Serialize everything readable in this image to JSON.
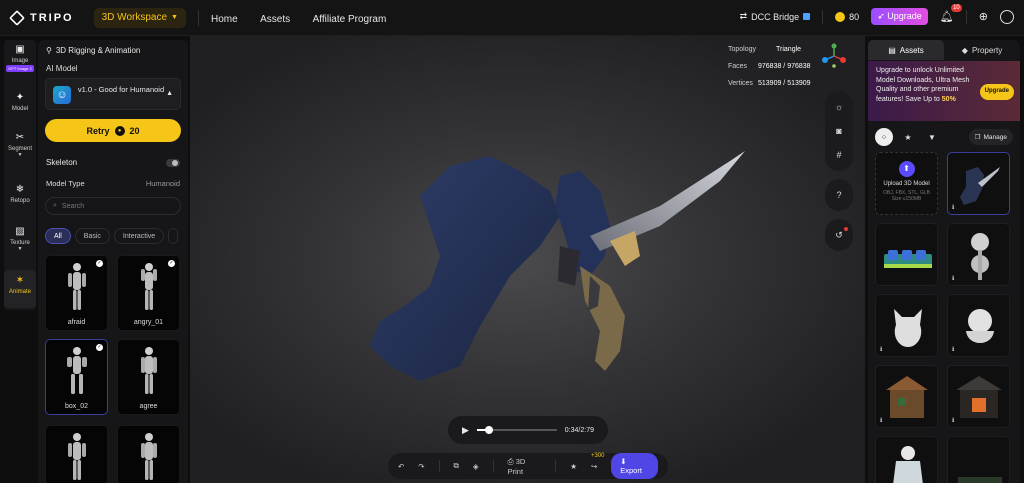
{
  "topbar": {
    "brand": "TRIPO",
    "workspace": "3D Workspace",
    "nav": [
      "Home",
      "Assets",
      "Affiliate Program"
    ],
    "dcc_bridge": "DCC Bridge",
    "credits": "80",
    "upgrade": "Upgrade",
    "notifications": "10"
  },
  "rail": [
    {
      "label": "Image",
      "tag": "GPT Image 2",
      "icon": "image-icon"
    },
    {
      "label": "Model",
      "icon": "sparkle-icon"
    },
    {
      "label": "Segment",
      "icon": "segment-icon"
    },
    {
      "label": "Retopo",
      "icon": "retopo-icon"
    },
    {
      "label": "Texture",
      "icon": "texture-icon"
    },
    {
      "label": "Animate",
      "icon": "animate-icon"
    }
  ],
  "panel": {
    "title": "3D Rigging & Animation",
    "ai_model_label": "AI Model",
    "model_name": "v1.0 - Good for Humanoid",
    "retry_label": "Retry",
    "retry_cost": "20",
    "skeleton_label": "Skeleton",
    "model_type_label": "Model Type",
    "model_type_value": "Humanoid",
    "search_placeholder": "Search",
    "filters": [
      "All",
      "Basic",
      "Interactive"
    ],
    "animations": [
      {
        "name": "afraid",
        "checked": true
      },
      {
        "name": "angry_01",
        "checked": true
      },
      {
        "name": "box_02",
        "checked": true
      },
      {
        "name": "agree",
        "checked": false
      },
      {
        "name": "",
        "checked": false
      },
      {
        "name": "",
        "checked": false
      }
    ]
  },
  "viewport": {
    "stats": [
      {
        "label": "Topology",
        "value": "Triangle"
      },
      {
        "label": "Faces",
        "value": "976838 / 976838"
      },
      {
        "label": "Vertices",
        "value": "513909 / 513909"
      }
    ],
    "time": "0:34/2:79",
    "progress": 0.15
  },
  "toolbar": {
    "print_label": "3D Print",
    "share_bonus": "+300",
    "export_label": "Export"
  },
  "rpanel": {
    "tab_assets": "Assets",
    "tab_property": "Property",
    "promo_text": "Upgrade to unlock Unlimited Model Downloads, Ultra Mesh Quality and other premium features! Save Up to",
    "promo_highlight": "50%",
    "promo_button": "Upgrade",
    "manage_label": "Manage",
    "upload_title": "Upload 3D Model",
    "upload_sub": "OBJ, FBX, STL, GLB Size ≤150MB"
  },
  "colors": {
    "accent": "#f5c518",
    "primary": "#4f46e5",
    "upgrade": "#c94dff"
  }
}
